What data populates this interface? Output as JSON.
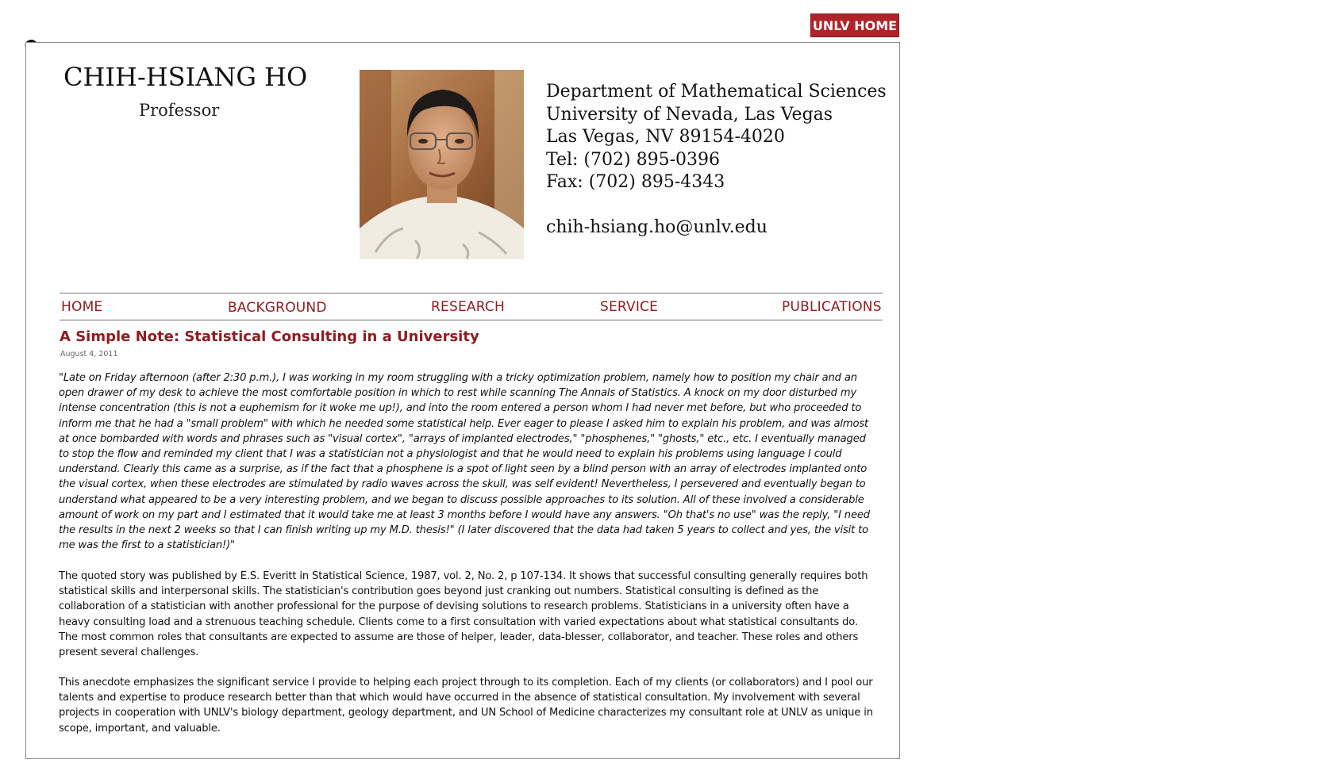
{
  "top_link": {
    "label": "UNLV HOME"
  },
  "profile": {
    "name": "CHIH-HSIANG HO",
    "title": "Professor"
  },
  "contact": {
    "department": "Department of Mathematical Sciences",
    "university": "University of Nevada, Las Vegas",
    "address": "Las Vegas, NV 89154-4020",
    "tel": "Tel: (702) 895-0396",
    "fax": "Fax: (702) 895-4343",
    "email": "chih-hsiang.ho@unlv.edu"
  },
  "nav": {
    "home": "HOME",
    "background": "BACKGROUND",
    "research": "RESEARCH",
    "service": "SERVICE",
    "publications": "PUBLICATIONS"
  },
  "article": {
    "title": "A Simple Note: Statistical Consulting in a University",
    "date": "August 4, 2011",
    "quote": "\"Late on Friday afternoon (after 2:30 p.m.), I was working in my room struggling with a tricky optimization problem, namely how to position my chair and an open drawer of my desk to achieve the most comfortable position in which to rest while scanning The Annals of Statistics. A knock on my door disturbed my intense concentration (this is not a euphemism for it woke me up!), and into the room entered a person whom I had never met before, but who proceeded to inform me that he had a \"small problem\" with which he needed some statistical help. Ever eager to please I asked him to explain his problem, and was almost at once bombarded with words and phrases such as \"visual cortex\", \"arrays of implanted electrodes,\" \"phosphenes,\" \"ghosts,\" etc., etc. I eventually managed to stop the flow and reminded my client that I was a statistician not a physiologist and that he would need to explain his problems using language I could understand. Clearly this came as a surprise, as if the fact that a phosphene is a spot of light seen by a blind person with an array of electrodes implanted onto the visual cortex, when these electrodes are stimulated by radio waves across the skull, was self evident! Nevertheless, I persevered and eventually began to understand what appeared to be a very interesting problem, and we began to discuss possible approaches to its solution. All of these involved a considerable amount of work on my part and I estimated that it would take me at least 3 months before I would have any answers. \"Oh that's no use\" was the reply, \"I need the results in the next 2 weeks so that I can finish writing up my M.D. thesis!\" (I later discovered that the data had taken 5 years to collect and yes, the visit to me was the first to a statistician!)\"",
    "paragraph1": "The quoted story was published by E.S. Everitt in Statistical Science, 1987, vol. 2, No. 2, p 107-134. It shows that successful consulting generally requires both statistical skills and interpersonal skills. The statistician's contribution goes beyond just cranking out numbers. Statistical consulting is defined as the collaboration of a statistician with another professional for the purpose of devising solutions to research problems. Statisticians in a university often have a heavy consulting load and a strenuous teaching schedule. Clients come to a first consultation with varied expectations about what statistical consultants do. The most common roles that consultants are expected to assume are those of helper, leader, data-blesser, collaborator, and teacher. These roles and others present several challenges.",
    "paragraph2": "This anecdote emphasizes the significant service I provide to helping each project through to its completion. Each of my clients (or collaborators) and I pool our talents and expertise to produce research better than that which would have occurred in the absence of statistical consultation. My involvement with several projects in cooperation with UNLV's biology department, geology department, and UN School of Medicine characterizes my consultant role at UNLV as unique in scope, important, and valuable."
  },
  "colors": {
    "accent": "#8e1d22",
    "button_bg": "#b0232a",
    "frame_border": "#8a8a8a"
  }
}
